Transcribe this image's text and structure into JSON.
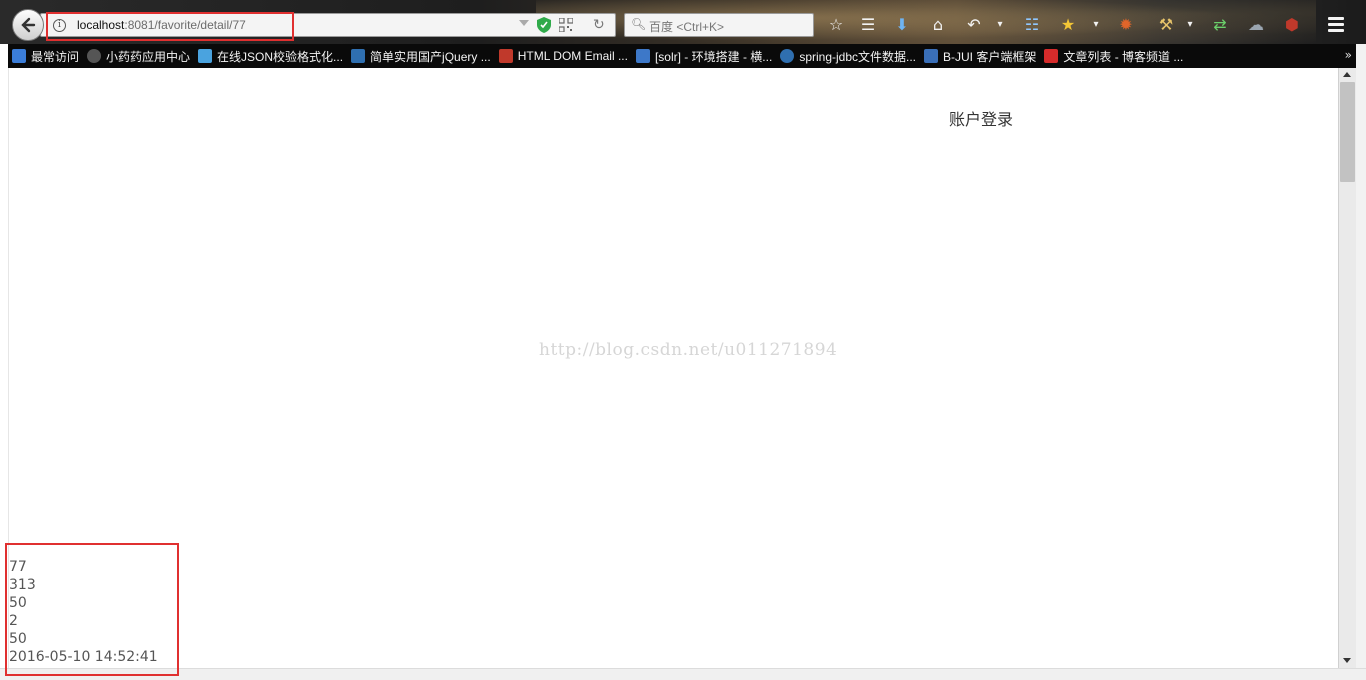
{
  "window": {
    "url_host": "localhost",
    "url_path": ":8081/favorite/detail/77",
    "search_placeholder": "百度 <Ctrl+K>"
  },
  "toolbar_icons": [
    "bookmark-star-icon",
    "reading-list-icon",
    "download-icon",
    "home-icon",
    "undo-icon",
    "translate-icon",
    "favorites-icon",
    "addon-icon",
    "tools-icon",
    "sync-icon",
    "cloud-icon",
    "ublock-icon"
  ],
  "bookmarks": [
    {
      "label": "最常访问",
      "color": "#3b7dd8"
    },
    {
      "label": "小药药应用中心",
      "color": "#555555"
    },
    {
      "label": "在线JSON校验格式化...",
      "color": "#4aa3df"
    },
    {
      "label": "简单实用国产jQuery ...",
      "color": "#2f6fb0"
    },
    {
      "label": "HTML DOM Email ...",
      "color": "#c0392b"
    },
    {
      "label": "[solr] - 环境搭建 - 横...",
      "color": "#3d78c8"
    },
    {
      "label": "spring-jdbc文件数据...",
      "color": "#2f6fb0"
    },
    {
      "label": "B-JUI 客户端框架",
      "color": "#3a6fb8"
    },
    {
      "label": "文章列表 - 博客频道 ...",
      "color": "#d62b2b"
    }
  ],
  "page": {
    "login_link": "账户登录",
    "watermark": "http://blog.csdn.net/u011271894",
    "details": [
      "77",
      "313",
      "50",
      "2",
      "50",
      "2016-05-10 14:52:41"
    ]
  }
}
